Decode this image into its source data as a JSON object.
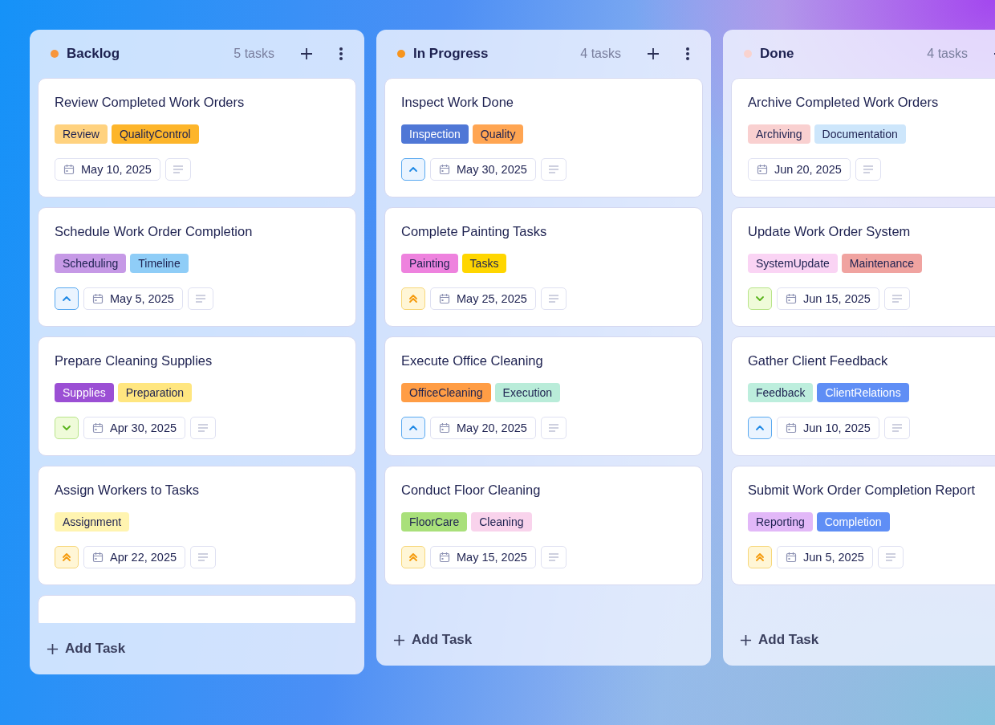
{
  "columns": [
    {
      "title": "Backlog",
      "color": "#f7953b",
      "count": "5 tasks",
      "clipped_below": true,
      "add_label": "Add Task",
      "cards": [
        {
          "title": "Review Completed Work Orders",
          "kind": "none",
          "date": "May 10, 2025",
          "tags": [
            {
              "label": "Review",
              "color": "#ffd27f"
            },
            {
              "label": "QualityControl",
              "color": "#fdb52a"
            }
          ]
        },
        {
          "title": "Schedule Work Order Completion",
          "kind": "medium",
          "date": "May 5, 2025",
          "tags": [
            {
              "label": "Scheduling",
              "color": "#c699e6"
            },
            {
              "label": "Timeline",
              "color": "#8fcdf7"
            }
          ]
        },
        {
          "title": "Prepare Cleaning Supplies",
          "kind": "low",
          "date": "Apr 30, 2025",
          "tags": [
            {
              "label": "Supplies",
              "color": "#9b4fd4"
            },
            {
              "label": "Preparation",
              "color": "#ffe680"
            }
          ]
        },
        {
          "title": "Assign Workers to Tasks",
          "kind": "high",
          "date": "Apr 22, 2025",
          "tags": [
            {
              "label": "Assignment",
              "color": "#fff4b0"
            }
          ]
        }
      ]
    },
    {
      "title": "In Progress",
      "color": "#f7941d",
      "count": "4 tasks",
      "clipped_below": false,
      "add_label": "Add Task",
      "cards": [
        {
          "title": "Inspect Work Done",
          "kind": "medium",
          "date": "May 30, 2025",
          "tags": [
            {
              "label": "Inspection",
              "color": "#4f77d6"
            },
            {
              "label": "Quality",
              "color": "#ffa552"
            }
          ]
        },
        {
          "title": "Complete Painting Tasks",
          "kind": "high",
          "date": "May 25, 2025",
          "tags": [
            {
              "label": "Painting",
              "color": "#ee82de"
            },
            {
              "label": "Tasks",
              "color": "#ffd600"
            }
          ]
        },
        {
          "title": "Execute Office Cleaning",
          "kind": "medium",
          "date": "May 20, 2025",
          "tags": [
            {
              "label": "OfficeCleaning",
              "color": "#ff9d45"
            },
            {
              "label": "Execution",
              "color": "#b9ecd9"
            }
          ]
        },
        {
          "title": "Conduct Floor Cleaning",
          "kind": "high",
          "date": "May 15, 2025",
          "tags": [
            {
              "label": "FloorCare",
              "color": "#a9e07a"
            },
            {
              "label": "Cleaning",
              "color": "#f9d3ec"
            }
          ]
        }
      ]
    },
    {
      "title": "Done",
      "color": "#f9d3cf",
      "count": "4 tasks",
      "clipped_below": false,
      "add_label": "Add Task",
      "cards": [
        {
          "title": "Archive Completed Work Orders",
          "kind": "none",
          "date": "Jun 20, 2025",
          "tags": [
            {
              "label": "Archiving",
              "color": "#f9d0d0"
            },
            {
              "label": "Documentation",
              "color": "#cde6fb"
            }
          ]
        },
        {
          "title": "Update Work Order System",
          "kind": "low",
          "date": "Jun 15, 2025",
          "tags": [
            {
              "label": "SystemUpdate",
              "color": "#fad4f4"
            },
            {
              "label": "Maintenance",
              "color": "#f0a3a0"
            }
          ]
        },
        {
          "title": "Gather Client Feedback",
          "kind": "medium",
          "date": "Jun 10, 2025",
          "tags": [
            {
              "label": "Feedback",
              "color": "#bdeedd"
            },
            {
              "label": "ClientRelations",
              "color": "#5f8ef5"
            }
          ]
        },
        {
          "title": "Submit Work Order Completion Report",
          "kind": "high",
          "date": "Jun 5, 2025",
          "tags": [
            {
              "label": "Reporting",
              "color": "#e2b8f8"
            },
            {
              "label": "Completion",
              "color": "#5f8ef5"
            }
          ]
        }
      ]
    }
  ]
}
